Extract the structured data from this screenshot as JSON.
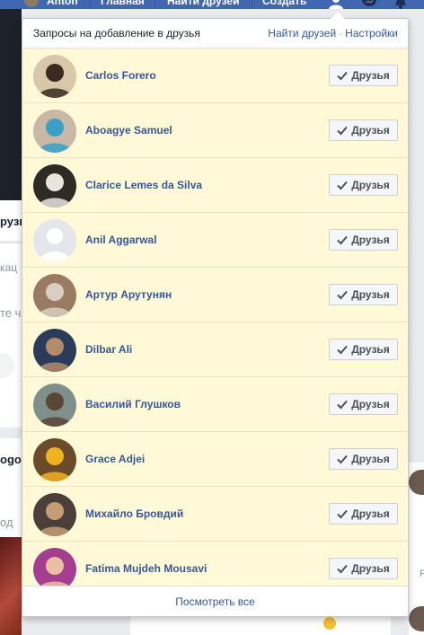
{
  "topbar": {
    "profile_name": "Anton",
    "home_label": "Главная",
    "find_friends_label": "Найти друзей",
    "create_label": "Создать",
    "bg_color": "#4267b2"
  },
  "background": {
    "left_fragment_1": "рузь",
    "left_fragment_2": "кац",
    "left_fragment_3": "те ч",
    "left_fragment_4": "ogo",
    "left_fragment_5": "од",
    "right_fragment": "F"
  },
  "dropdown": {
    "title": "Запросы на добавление в друзья",
    "find_friends_link": "Найти друзей",
    "settings_link": "Настройки",
    "separator": "·",
    "see_all": "Посмотреть все",
    "row_bg": "#fff9d7",
    "requests": [
      {
        "name": "Carlos Forero",
        "button": "Друзья",
        "avatar_icon": "user-photo-icon",
        "avatar_colors": [
          "#d8c7a8",
          "#3b2a20"
        ]
      },
      {
        "name": "Aboagye Samuel",
        "button": "Друзья",
        "avatar_icon": "user-photo-icon",
        "avatar_colors": [
          "#c9b8a6",
          "#3aa0c8"
        ]
      },
      {
        "name": "Clarice Lemes da Silva",
        "button": "Друзья",
        "avatar_icon": "user-photo-icon",
        "avatar_colors": [
          "#2e2a26",
          "#e9e4dc"
        ]
      },
      {
        "name": "Anil Aggarwal",
        "button": "Друзья",
        "avatar_icon": "default-avatar-icon",
        "avatar_colors": [
          "#e4e6eb",
          "#ffffff"
        ]
      },
      {
        "name": "Артур Арутунян",
        "button": "Друзья",
        "avatar_icon": "user-photo-icon",
        "avatar_colors": [
          "#9a7b62",
          "#d9cfc1"
        ]
      },
      {
        "name": "Dilbar Ali",
        "button": "Друзья",
        "avatar_icon": "user-photo-icon",
        "avatar_colors": [
          "#2a3c5a",
          "#b38a6a"
        ]
      },
      {
        "name": "Василий Глушков",
        "button": "Друзья",
        "avatar_icon": "user-photo-icon",
        "avatar_colors": [
          "#7f8f8a",
          "#5a4636"
        ]
      },
      {
        "name": "Grace Adjei",
        "button": "Друзья",
        "avatar_icon": "user-photo-icon",
        "avatar_colors": [
          "#6b4b2a",
          "#f0b21e"
        ]
      },
      {
        "name": "Михайло Бровдий",
        "button": "Друзья",
        "avatar_icon": "user-photo-icon",
        "avatar_colors": [
          "#4a3f39",
          "#c69c74"
        ]
      },
      {
        "name": "Fatima Mujdeh Mousavi",
        "button": "Друзья",
        "avatar_icon": "user-photo-icon",
        "avatar_colors": [
          "#a33f8e",
          "#e9c0a4"
        ]
      }
    ]
  }
}
